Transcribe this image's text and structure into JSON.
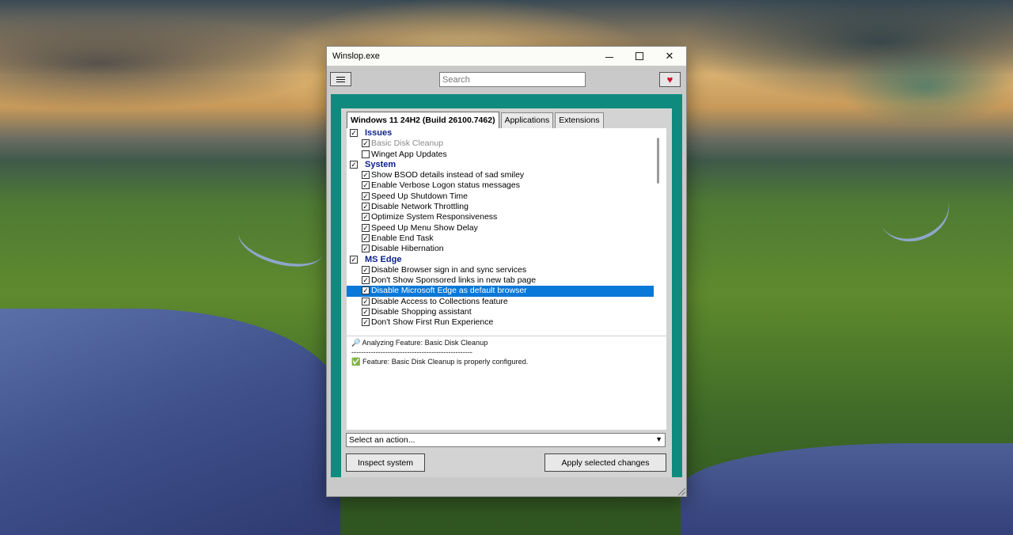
{
  "window": {
    "title": "Winslop.exe",
    "minimize": "",
    "maximize": "",
    "close": "✕"
  },
  "toolbar": {
    "search_placeholder": "Search",
    "heart_glyph": "♥"
  },
  "tabs": [
    {
      "label": "Windows 11 24H2 (Build 26100.7462)",
      "active": true
    },
    {
      "label": "Applications",
      "active": false
    },
    {
      "label": "Extensions",
      "active": false
    }
  ],
  "tree": [
    {
      "type": "cat",
      "label": "Issues",
      "checked": true
    },
    {
      "type": "item",
      "label": "Basic Disk Cleanup",
      "checked": true,
      "grey": true
    },
    {
      "type": "item",
      "label": "Winget App Updates",
      "checked": false
    },
    {
      "type": "cat",
      "label": "System",
      "checked": true
    },
    {
      "type": "item",
      "label": "Show BSOD details instead of sad smiley",
      "checked": true
    },
    {
      "type": "item",
      "label": "Enable Verbose Logon status messages",
      "checked": true
    },
    {
      "type": "item",
      "label": "Speed Up Shutdown Time",
      "checked": true
    },
    {
      "type": "item",
      "label": "Disable Network Throttling",
      "checked": true
    },
    {
      "type": "item",
      "label": "Optimize System Responsiveness",
      "checked": true
    },
    {
      "type": "item",
      "label": "Speed Up Menu Show Delay",
      "checked": true
    },
    {
      "type": "item",
      "label": "Enable End Task",
      "checked": true
    },
    {
      "type": "item",
      "label": "Disable Hibernation",
      "checked": true
    },
    {
      "type": "cat",
      "label": "MS Edge",
      "checked": true
    },
    {
      "type": "item",
      "label": "Disable Browser sign in and sync services",
      "checked": true
    },
    {
      "type": "item",
      "label": "Don't Show Sponsored links in new tab page",
      "checked": true
    },
    {
      "type": "item",
      "label": "Disable Microsoft Edge as default browser",
      "checked": true,
      "selected": true
    },
    {
      "type": "item",
      "label": "Disable Access to Collections feature",
      "checked": true
    },
    {
      "type": "item",
      "label": "Disable Shopping assistant",
      "checked": true
    },
    {
      "type": "item",
      "label": "Don't Show First Run Experience",
      "checked": true
    }
  ],
  "log": {
    "line1": "🔎 Analyzing Feature: Basic Disk Cleanup",
    "line2": "--------------------------------------------------",
    "line3": "✅ Feature: Basic Disk Cleanup is properly configured."
  },
  "action_select": {
    "value": "Select an action...",
    "arrow": "▼"
  },
  "buttons": {
    "inspect": "Inspect system",
    "apply": "Apply selected changes"
  }
}
